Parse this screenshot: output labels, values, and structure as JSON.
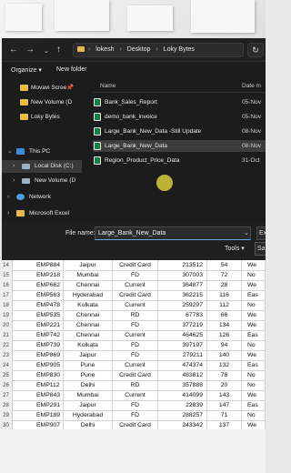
{
  "explorer": {
    "nav_back": "←",
    "nav_forward": "→",
    "nav_up": "↑",
    "breadcrumbs": [
      "lokesh",
      "Desktop",
      "Loky Bytes"
    ],
    "refresh_glyph": "↻",
    "commands": {
      "organize": "Organize ▾",
      "new_folder": "New folder"
    },
    "nav_items": [
      {
        "label": "Movavi Scree📌",
        "icon": "folder-icon"
      },
      {
        "label": "New Volume (D",
        "icon": "folder-icon"
      },
      {
        "label": "Loky Bytes",
        "icon": "folder-icon"
      },
      {
        "label": "This PC",
        "icon": "computer-icon"
      },
      {
        "label": "Local Disk (C:)",
        "icon": "drive-icon"
      },
      {
        "label": "New Volume (D",
        "icon": "drive-icon"
      },
      {
        "label": "Network",
        "icon": "network-icon"
      },
      {
        "label": "Microsoft Excel",
        "icon": "folder-icon"
      }
    ],
    "columns": {
      "name": "Name",
      "date": "Date m"
    },
    "files": [
      {
        "name": "Bank_Sales_Report",
        "date": "05-Nov"
      },
      {
        "name": "demo_bank_invoice",
        "date": "05-Nov"
      },
      {
        "name": "Large_Bank_New_Data -Still Update",
        "date": "08-Nov"
      },
      {
        "name": "Large_Bank_New_Data",
        "date": "08-Nov"
      },
      {
        "name": "Region_Product_Price_Data",
        "date": "31-Oct"
      }
    ],
    "selected_file_index": 3
  },
  "save": {
    "filename_label": "File name:",
    "filename_value": "Large_Bank_New_Data",
    "type_value": "Ex",
    "tools_label": "Tools",
    "save_label": "Sa"
  },
  "sheet": {
    "rows": [
      {
        "n": "14",
        "emp": "EMP884",
        "city": "Jaipur",
        "type": "Credit Card",
        "amount": "213512",
        "age": "54",
        "region": "We"
      },
      {
        "n": "15",
        "emp": "EMP218",
        "city": "Mumbai",
        "type": "FD",
        "amount": "307003",
        "age": "72",
        "region": "No"
      },
      {
        "n": "16",
        "emp": "EMP662",
        "city": "Chennai",
        "type": "Current",
        "amount": "364877",
        "age": "28",
        "region": "We"
      },
      {
        "n": "17",
        "emp": "EMP563",
        "city": "Hyderabad",
        "type": "Credit Card",
        "amount": "362215",
        "age": "116",
        "region": "Eas"
      },
      {
        "n": "18",
        "emp": "EMP478",
        "city": "Kolkata",
        "type": "Current",
        "amount": "259297",
        "age": "112",
        "region": "No"
      },
      {
        "n": "19",
        "emp": "EMP535",
        "city": "Chennai",
        "type": "RD",
        "amount": "67783",
        "age": "66",
        "region": "We"
      },
      {
        "n": "20",
        "emp": "EMP221",
        "city": "Chennai",
        "type": "FD",
        "amount": "377219",
        "age": "134",
        "region": "We"
      },
      {
        "n": "21",
        "emp": "EMP742",
        "city": "Chennai",
        "type": "Current",
        "amount": "464625",
        "age": "126",
        "region": "Eas"
      },
      {
        "n": "22",
        "emp": "EMP739",
        "city": "Kolkata",
        "type": "FD",
        "amount": "397197",
        "age": "94",
        "region": "No"
      },
      {
        "n": "23",
        "emp": "EMP869",
        "city": "Jaipur",
        "type": "FD",
        "amount": "279211",
        "age": "140",
        "region": "We"
      },
      {
        "n": "24",
        "emp": "EMP905",
        "city": "Pune",
        "type": "Current",
        "amount": "474374",
        "age": "132",
        "region": "Eas"
      },
      {
        "n": "25",
        "emp": "EMP830",
        "city": "Pune",
        "type": "Credit Card",
        "amount": "483812",
        "age": "78",
        "region": "No"
      },
      {
        "n": "26",
        "emp": "EMP112",
        "city": "Delhi",
        "type": "RD",
        "amount": "357888",
        "age": "20",
        "region": "No"
      },
      {
        "n": "27",
        "emp": "EMP843",
        "city": "Mumbai",
        "type": "Current",
        "amount": "414099",
        "age": "143",
        "region": "We"
      },
      {
        "n": "28",
        "emp": "EMP291",
        "city": "Jaipur",
        "type": "FD",
        "amount": "22839",
        "age": "147",
        "region": "Eas"
      },
      {
        "n": "29",
        "emp": "EMP189",
        "city": "Hyderabad",
        "type": "FD",
        "amount": "288257",
        "age": "71",
        "region": "No"
      },
      {
        "n": "30",
        "emp": "EMP907",
        "city": "Delhi",
        "type": "Credit Card",
        "amount": "243342",
        "age": "137",
        "region": "We"
      }
    ]
  },
  "colors": {
    "dialog_bg": "#1c1c1c",
    "excel_icon": "#1f7a46",
    "folder_icon": "#e8b94b",
    "cursor_highlight": "#f0e63c",
    "selection": "#3d3d3d"
  }
}
